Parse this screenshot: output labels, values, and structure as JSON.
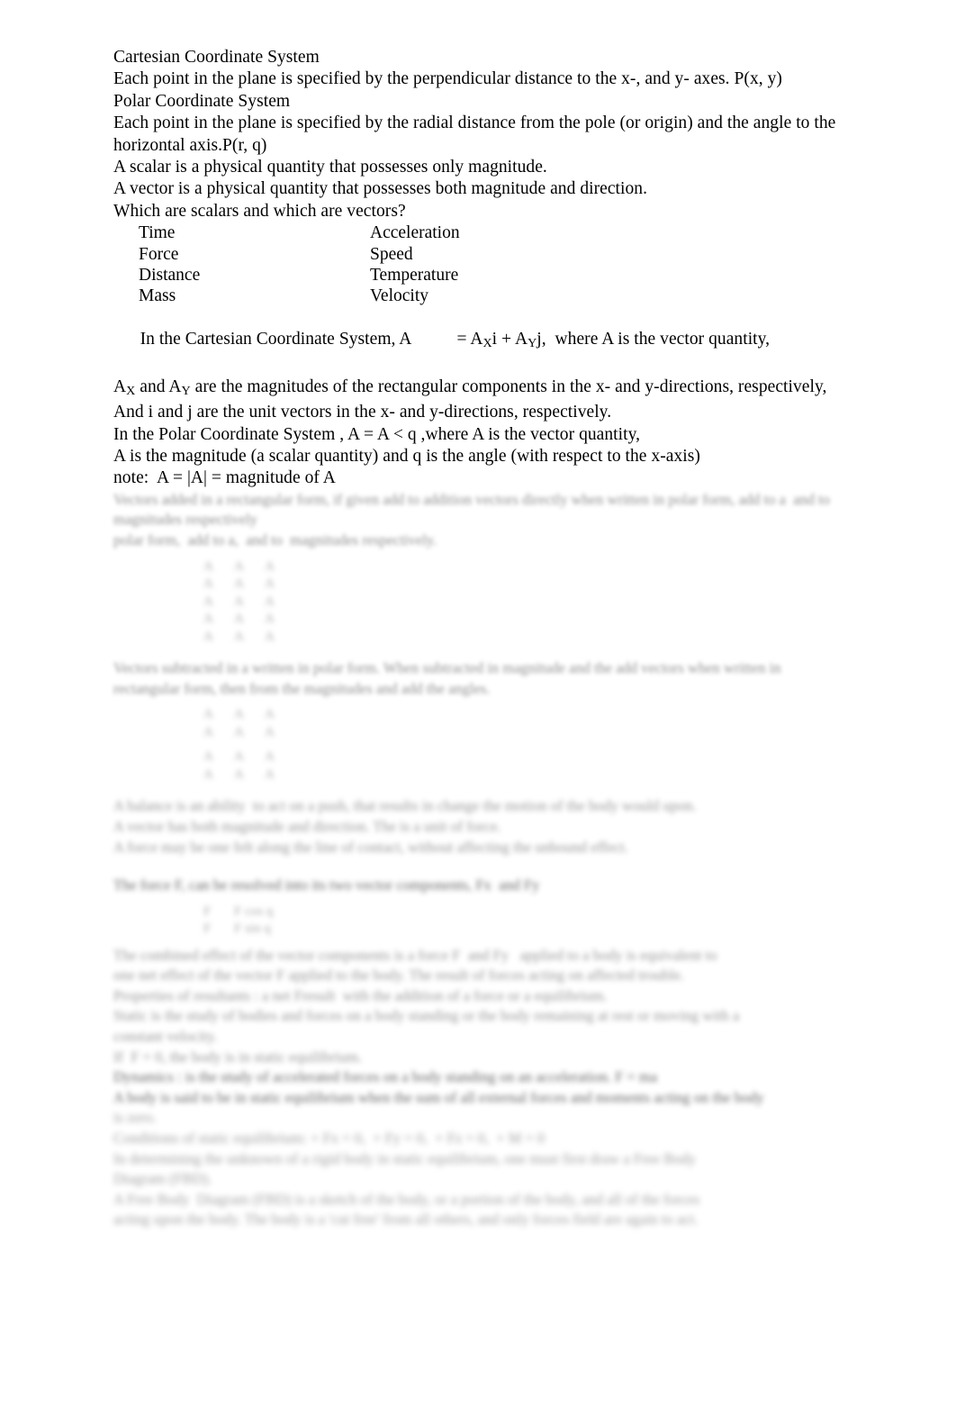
{
  "document": {
    "type": "lecture-notes",
    "subject": "Vectors and Coordinate Systems",
    "page_background": "#ffffff",
    "text_color": "#000000",
    "blurred_text_color": "#6e6e6e"
  },
  "legible": {
    "l1": "Cartesian Coordinate System",
    "l2": "Each point in the plane is specified by the perpendicular distance to the x-, and y- axes. P(x, y)",
    "l3": "Polar Coordinate System",
    "l4": "Each point in the plane is specified by the radial distance from the pole (or origin) and the angle to the horizontal axis.P(r, q)",
    "l5": "A scalar is a physical quantity that possesses only magnitude.",
    "l6": "A vector is a physical quantity that possesses both magnitude and direction.",
    "l7": "Which are scalars and which are vectors?",
    "quantities": [
      {
        "left": "Time",
        "right": "Acceleration"
      },
      {
        "left": "Force",
        "right": "Speed"
      },
      {
        "left": "Distance",
        "right": "Temperature"
      },
      {
        "left": "Mass",
        "right": "Velocity"
      }
    ],
    "cartesian_eq_pre": "In the Cartesian Coordinate System, A",
    "cartesian_eq_eq": "= A",
    "cartesian_eq_sub_x": "X",
    "cartesian_eq_mid": "i + A",
    "cartesian_eq_sub_y": "Y",
    "cartesian_eq_post": "j,  where A is the vector quantity,",
    "magnitudes_pre": "A",
    "magnitudes_sub_x": "X",
    "magnitudes_mid": " and A",
    "magnitudes_sub_y": "Y",
    "magnitudes_post": " are the magnitudes of the rectangular components in the x- and y-directions, respectively,",
    "unit_vectors": "And i and j  are the unit vectors in the x- and y-directions, respectively.",
    "polar_eq": "In the Polar Coordinate System    , A = A < q ,where A is the vector quantity,",
    "polar_desc": "A is the magnitude (a scalar quantity) and q is the angle (with respect to the x-axis)",
    "note": "note:  A = |A| = magnitude of A"
  },
  "blurred": {
    "note": "Remaining page content is blurred and illegible in the source image.",
    "p1_line1": "Vectors added in a rectangular form, if given add to addition vectors directly when written in polar form, add to a  and to  magnitudes respectively",
    "p1_line2": "polar form,  add to a,  and to  magnitudes respectively.",
    "table1": [
      [
        "A",
        "A",
        "A"
      ],
      [
        "A",
        "A",
        "A"
      ],
      [
        "A",
        "A",
        "A"
      ],
      [
        "A",
        "A",
        "A"
      ],
      [
        "A",
        "A",
        "A"
      ]
    ],
    "p2_line1": "Vectors subtracted in a written in polar form. When subtracted in magnitude and the add vectors when written in",
    "p2_line2": "rectangular form, then from the magnitudes and add the angles.",
    "table2": [
      [
        "A",
        "A",
        "A"
      ],
      [
        "A",
        "A",
        "A"
      ],
      [
        "A",
        "A",
        "A"
      ],
      [
        "A",
        "A",
        "A"
      ]
    ],
    "p3_line1": "A balance is an ability  to act on a push, that results in change the motion of the body would upon.",
    "p3_line2": "A vector has both magnitude and direction. The is a unit of force.",
    "p3_line3": "A force may be one felt along the line of contact, without affecting the unbound effect.",
    "p4_line1": "The force F, can be resolved into its two vector components, Fx  and Fy",
    "table3": [
      [
        "F",
        "F cos q"
      ],
      [
        "F",
        "F sin q"
      ]
    ],
    "p5_line1": "The combined effect of the vector components is a force F  and Fy   applied to a body is equivalent to",
    "p5_line2": "one net effect of the vector F applied to the body. The result of forces acting on affected trouble.",
    "p5_line3": "Properties of resultants : a net Fresult  with the addition of a force or a equilibrium.",
    "p6_line1": "Static is the study of bodies and forces on a body standing or the body remaining at rest or moving with a",
    "p6_line2": "constant velocity.",
    "p6_line3": "If  F = 0, the body is in static equilibrium.",
    "p7_line1": "Dynamics : is the study of accelerated forces on a body standing on an acceleration. F = ma",
    "p7_line2": "A body is said to be in static equilibrium when the sum of all external forces and moments acting on the body",
    "p7_line3": "is zero.",
    "p7_line4": "Conditions of static equilibrium: + Fx = 0,  + Fy = 0,  + Fz = 0,  + M = 0",
    "p8_line1": "In determining the unknown of a rigid body in static equilibrium, one must first draw a Free Body",
    "p8_line2": "Diagram (FBD).",
    "p8_line3": "A Free Body  Diagram (FBD) is a sketch of the body, or a portion of the body, and all of the forces",
    "p8_line4": "acting upon the body. The body is a 'cut free' from all others, and only forces field are again to act."
  }
}
